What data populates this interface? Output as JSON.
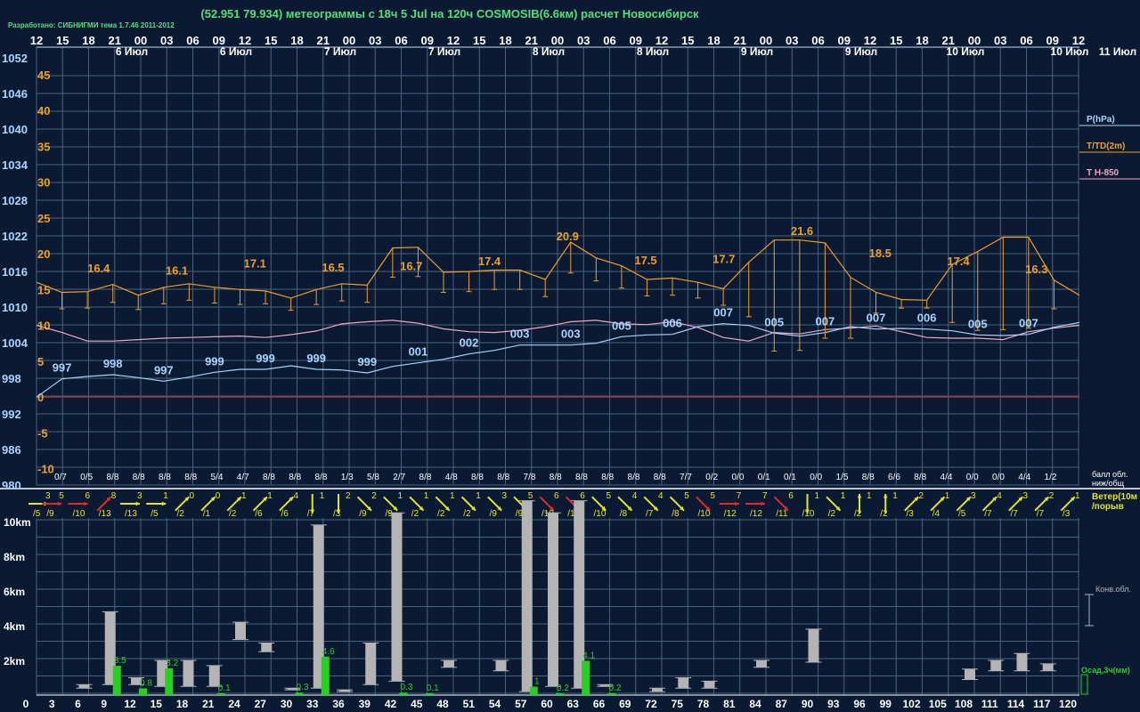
{
  "title": "(52.951 79.934) метеограммы с  18ч 5 Jul на 120ч COSMOSIB(6.6км) расчет Новосибирск",
  "credit": "Разработано: СИБНИГМИ тема 1.7.46 2011-2012",
  "colors": {
    "background": "#0a1a33",
    "grid": "#4a6280",
    "temperature": "#f0a020",
    "pressure": "#a8d4ff",
    "t850": "#f0a8c0",
    "zero_line": "#a83030",
    "cloud_bar": "#b4b4b4",
    "precip_bar": "#22d21e",
    "title": "#52e07a",
    "wind_yellow": "#e6e61e",
    "wind_red": "#e62828"
  },
  "chart_data": [
    {
      "type": "line",
      "name": "meteogram",
      "hour_ticks": [
        "12",
        "15",
        "18",
        "21",
        "00",
        "03",
        "06",
        "09",
        "12",
        "15",
        "18",
        "21",
        "00",
        "03",
        "06",
        "09",
        "12",
        "15",
        "18",
        "21",
        "00",
        "03",
        "06",
        "09",
        "12",
        "15",
        "18",
        "21",
        "00",
        "03",
        "06",
        "09",
        "12",
        "15",
        "18",
        "21",
        "00",
        "03",
        "06",
        "09",
        "12"
      ],
      "day_labels": [
        "6 Июл",
        "6 Июл",
        "7 Июл",
        "7 Июл",
        "8 Июл",
        "8 Июл",
        "9 Июл",
        "9 Июл",
        "10 Июл",
        "10 Июл",
        "11 Июл"
      ],
      "pressure_axis": {
        "ticks": [
          "1052",
          "1046",
          "1040",
          "1034",
          "1028",
          "1022",
          "1016",
          "1010",
          "1004",
          "998",
          "992",
          "986",
          "980"
        ],
        "ylim": [
          980,
          1052
        ]
      },
      "temperature_axis": {
        "ticks": [
          "45",
          "40",
          "35",
          "30",
          "25",
          "20",
          "15",
          "10",
          "5",
          "0",
          "-5",
          "-10"
        ],
        "ylim": [
          -12,
          48
        ]
      },
      "legend": [
        "P(hPa)",
        "T/TD(2m)",
        "T H-850"
      ],
      "x_hours": [
        0,
        3,
        6,
        9,
        12,
        15,
        18,
        21,
        24,
        27,
        30,
        33,
        36,
        39,
        42,
        45,
        48,
        51,
        54,
        57,
        60,
        63,
        66,
        69,
        72,
        75,
        78,
        81,
        84,
        87,
        90,
        93,
        96,
        99,
        102,
        105,
        108,
        111,
        114,
        117,
        120
      ],
      "series": [
        {
          "name": "T/TD(2m)",
          "values": [
            16.0,
            14.6,
            14.7,
            15.7,
            14.2,
            15.3,
            15.8,
            15.3,
            15.0,
            14.8,
            13.8,
            15.0,
            15.8,
            15.6,
            20.8,
            20.9,
            17.4,
            17.5,
            17.7,
            17.7,
            16.4,
            21.6,
            19.4,
            18.3,
            16.4,
            16.6,
            16.0,
            15.1,
            18.8,
            21.9,
            21.9,
            21.5,
            16.7,
            14.6,
            13.6,
            13.5,
            18.5,
            20.3,
            22.3,
            22.3,
            16.3,
            14.2
          ],
          "dew_points": [
            null,
            12.3,
            12.4,
            13.2,
            12.2,
            13.0,
            13.5,
            13.1,
            12.9,
            13.0,
            12.1,
            12.9,
            13.4,
            13.2,
            16.7,
            16.8,
            14.6,
            14.7,
            15.0,
            15.0,
            14.0,
            17.3,
            16.2,
            15.2,
            14.1,
            14.2,
            13.8,
            12.8,
            11.2,
            6.4,
            6.5,
            8.2,
            8.2,
            11.7,
            12.4,
            12.4,
            10.4,
            9.3,
            9.4,
            9.6,
            12.3,
            null
          ],
          "labels": [
            {
              "h": 9,
              "v": "16.4"
            },
            {
              "h": 18,
              "v": "16.1"
            },
            {
              "h": 27,
              "v": "17.1"
            },
            {
              "h": 36,
              "v": "16.5"
            },
            {
              "h": 45,
              "v": "16.7"
            },
            {
              "h": 54,
              "v": "17.4"
            },
            {
              "h": 63,
              "v": "20.9"
            },
            {
              "h": 72,
              "v": "17.5"
            },
            {
              "h": 81,
              "v": "17.7"
            },
            {
              "h": 90,
              "v": "21.6"
            },
            {
              "h": 99,
              "v": "18.5"
            },
            {
              "h": 108,
              "v": "17.4"
            },
            {
              "h": 117,
              "v": "16.3"
            }
          ]
        },
        {
          "name": "P(hPa)",
          "values": [
            994.8,
            997.9,
            998.3,
            998.6,
            998.1,
            997.5,
            998.2,
            999.0,
            999.5,
            999.5,
            1000.1,
            999.5,
            999.4,
            998.9,
            1000.0,
            1000.6,
            1001.2,
            1002.1,
            1002.7,
            1003.6,
            1003.6,
            1003.6,
            1003.9,
            1005.0,
            1005.3,
            1005.4,
            1006.7,
            1007.2,
            1006.9,
            1005.6,
            1005.1,
            1005.7,
            1006.7,
            1006.3,
            1006.4,
            1006.3,
            1006.0,
            1005.3,
            1005.2,
            1005.4,
            1006.6,
            1007.4
          ],
          "labels": [
            "997",
            "998",
            "997",
            "999",
            "999",
            "999",
            "999",
            "001",
            "002",
            "003",
            "003",
            "005",
            "006",
            "007",
            "005",
            "007",
            "007",
            "006",
            "005",
            "007"
          ]
        },
        {
          "name": "T H-850",
          "values": [
            10.0,
            9.0,
            7.8,
            7.8,
            8.0,
            8.2,
            8.3,
            8.4,
            8.5,
            8.3,
            8.7,
            9.2,
            10.2,
            10.5,
            10.7,
            10.3,
            9.5,
            9.1,
            9.0,
            9.3,
            9.8,
            10.5,
            10.7,
            10.2,
            10.1,
            10.5,
            9.7,
            8.3,
            7.8,
            9.0,
            8.8,
            9.4,
            9.6,
            9.9,
            9.1,
            8.3,
            8.2,
            8.2,
            8.0,
            9.1,
            9.6,
            10.0
          ]
        }
      ]
    },
    {
      "type": "table",
      "name": "cloud-cover-and-wind",
      "cloud_cover_label": "балл обл. ниж/общ",
      "cloud_cover": [
        "0/7",
        "0/5",
        "8/8",
        "8/8",
        "8/8",
        "8/8",
        "5/4",
        "4/7",
        "8/8",
        "8/8",
        "8/8",
        "1/3",
        "5/8",
        "2/7",
        "8/8",
        "4/8",
        "8/8",
        "8/8",
        "7/8",
        "8/8",
        "8/8",
        "8/8",
        "8/8",
        "8/8",
        "7/7",
        "0/2",
        "0/0",
        "0/1",
        "0/1",
        "0/0",
        "1/5",
        "8/8",
        "6/6",
        "8/8",
        "4/4",
        "0/0",
        "0/0",
        "4/4",
        "1/2"
      ],
      "wind_label": "Ветер(10м)/порыв",
      "wind": [
        {
          "s": "3",
          "g": "/5",
          "dir": "e",
          "c": "yellow"
        },
        {
          "s": "5",
          "g": "/9",
          "dir": "e",
          "c": "red"
        },
        {
          "s": "6",
          "g": "/10",
          "dir": "e",
          "c": "red"
        },
        {
          "s": "8",
          "g": "/13",
          "dir": "ne",
          "c": "red"
        },
        {
          "s": "3",
          "g": "/13",
          "dir": "e",
          "c": "yellow"
        },
        {
          "s": "1",
          "g": "/5",
          "dir": "e",
          "c": "yellow"
        },
        {
          "s": "0",
          "g": "/2",
          "dir": "ne",
          "c": "yellow"
        },
        {
          "s": "0",
          "g": "/1",
          "dir": "ne",
          "c": "yellow"
        },
        {
          "s": "1",
          "g": "/2",
          "dir": "ne",
          "c": "yellow"
        },
        {
          "s": "1",
          "g": "/6",
          "dir": "ne",
          "c": "yellow"
        },
        {
          "s": "4",
          "g": "/6",
          "dir": "ne",
          "c": "yellow"
        },
        {
          "s": "1",
          "g": "/7",
          "dir": "s",
          "c": "yellow"
        },
        {
          "s": "2",
          "g": "/3",
          "dir": "s",
          "c": "yellow"
        },
        {
          "s": "2",
          "g": "/9",
          "dir": "se",
          "c": "yellow"
        },
        {
          "s": "1",
          "g": "/9",
          "dir": "se",
          "c": "yellow"
        },
        {
          "s": "1",
          "g": "/2",
          "dir": "se",
          "c": "yellow"
        },
        {
          "s": "1",
          "g": "/2",
          "dir": "se",
          "c": "yellow"
        },
        {
          "s": "1",
          "g": "/2",
          "dir": "se",
          "c": "yellow"
        },
        {
          "s": "3",
          "g": "/9",
          "dir": "se",
          "c": "yellow"
        },
        {
          "s": "5",
          "g": "/9",
          "dir": "se",
          "c": "yellow"
        },
        {
          "s": "6",
          "g": "/10",
          "dir": "se",
          "c": "red"
        },
        {
          "s": "6",
          "g": "/11",
          "dir": "se",
          "c": "red"
        },
        {
          "s": "5",
          "g": "/10",
          "dir": "se",
          "c": "yellow"
        },
        {
          "s": "4",
          "g": "/8",
          "dir": "se",
          "c": "yellow"
        },
        {
          "s": "4",
          "g": "/7",
          "dir": "se",
          "c": "yellow"
        },
        {
          "s": "5",
          "g": "/8",
          "dir": "se",
          "c": "yellow"
        },
        {
          "s": "5",
          "g": "/10",
          "dir": "se",
          "c": "red"
        },
        {
          "s": "7",
          "g": "/12",
          "dir": "e",
          "c": "red"
        },
        {
          "s": "7",
          "g": "/12",
          "dir": "e",
          "c": "red"
        },
        {
          "s": "6",
          "g": "/11",
          "dir": "se",
          "c": "red"
        },
        {
          "s": "1",
          "g": "/10",
          "dir": "s",
          "c": "yellow"
        },
        {
          "s": "1",
          "g": "/2",
          "dir": "se",
          "c": "yellow"
        },
        {
          "s": "1",
          "g": "/2",
          "dir": "n",
          "c": "yellow"
        },
        {
          "s": "1",
          "g": "/2",
          "dir": "n",
          "c": "yellow"
        },
        {
          "s": "2",
          "g": "/3",
          "dir": "ne",
          "c": "yellow"
        },
        {
          "s": "1",
          "g": "/4",
          "dir": "ne",
          "c": "yellow"
        },
        {
          "s": "3",
          "g": "/5",
          "dir": "ne",
          "c": "yellow"
        },
        {
          "s": "4",
          "g": "/7",
          "dir": "ne",
          "c": "yellow"
        },
        {
          "s": "3",
          "g": "/7",
          "dir": "ne",
          "c": "yellow"
        },
        {
          "s": "2",
          "g": "/7",
          "dir": "ne",
          "c": "yellow"
        },
        {
          "s": "1",
          "g": "/3",
          "dir": "ne",
          "c": "yellow"
        }
      ]
    },
    {
      "type": "bar",
      "name": "convective-clouds-and-precip",
      "height_axis": {
        "ticks": [
          "10km",
          "8km",
          "6km",
          "4km",
          "2km"
        ],
        "ylim": [
          0,
          12
        ]
      },
      "x_ticks": [
        "0",
        "3",
        "6",
        "9",
        "12",
        "15",
        "18",
        "21",
        "24",
        "27",
        "30",
        "33",
        "36",
        "39",
        "42",
        "45",
        "48",
        "51",
        "54",
        "57",
        "60",
        "63",
        "66",
        "69",
        "72",
        "75",
        "78",
        "81",
        "84",
        "87",
        "90",
        "93",
        "96",
        "99",
        "102",
        "105",
        "108",
        "111",
        "114",
        "117",
        "120"
      ],
      "legend": [
        "Конв.обл.",
        "Осад,3ч(мм)"
      ],
      "clouds_km": [
        {
          "h": 6,
          "b": 0.4,
          "t": 0.6
        },
        {
          "h": 9,
          "b": 0.6,
          "t": 4.8
        },
        {
          "h": 12,
          "b": 0.6,
          "t": 1.0
        },
        {
          "h": 15,
          "b": 0.5,
          "t": 2.0
        },
        {
          "h": 18,
          "b": 0.5,
          "t": 2.0
        },
        {
          "h": 21,
          "b": 0.5,
          "t": 1.7
        },
        {
          "h": 24,
          "b": 3.2,
          "t": 4.2
        },
        {
          "h": 27,
          "b": 2.5,
          "t": 3.0
        },
        {
          "h": 30,
          "b": 0.3,
          "t": 0.4
        },
        {
          "h": 33,
          "b": 0.4,
          "t": 9.8
        },
        {
          "h": 36,
          "b": 0.2,
          "t": 0.3
        },
        {
          "h": 39,
          "b": 0.6,
          "t": 3.0
        },
        {
          "h": 42,
          "b": 0.8,
          "t": 10.5
        },
        {
          "h": 48,
          "b": 1.6,
          "t": 2.0
        },
        {
          "h": 54,
          "b": 1.4,
          "t": 2.0
        },
        {
          "h": 57,
          "b": 0.2,
          "t": 11.2
        },
        {
          "h": 60,
          "b": 0.5,
          "t": 10.5
        },
        {
          "h": 63,
          "b": 0.4,
          "t": 11.2
        },
        {
          "h": 66,
          "b": 0.5,
          "t": 0.6
        },
        {
          "h": 72,
          "b": 0.2,
          "t": 0.4
        },
        {
          "h": 75,
          "b": 0.4,
          "t": 1.0
        },
        {
          "h": 78,
          "b": 0.4,
          "t": 0.8
        },
        {
          "h": 84,
          "b": 1.6,
          "t": 2.0
        },
        {
          "h": 90,
          "b": 1.9,
          "t": 3.8
        },
        {
          "h": 108,
          "b": 0.9,
          "t": 1.5
        },
        {
          "h": 111,
          "b": 1.4,
          "t": 2.0
        },
        {
          "h": 114,
          "b": 1.4,
          "t": 2.4
        },
        {
          "h": 117,
          "b": 1.4,
          "t": 1.8
        }
      ],
      "precip_mm": [
        {
          "h": 9,
          "v": 3.5
        },
        {
          "h": 12,
          "v": 0.8
        },
        {
          "h": 15,
          "v": 3.2
        },
        {
          "h": 21,
          "v": 0.1
        },
        {
          "h": 30,
          "v": 0.3
        },
        {
          "h": 33,
          "v": 4.6
        },
        {
          "h": 42,
          "v": 0.3
        },
        {
          "h": 45,
          "v": 0.1
        },
        {
          "h": 57,
          "v": 1
        },
        {
          "h": 60,
          "v": 0.2
        },
        {
          "h": 63,
          "v": 4.1
        },
        {
          "h": 66,
          "v": 0.2
        }
      ]
    }
  ]
}
